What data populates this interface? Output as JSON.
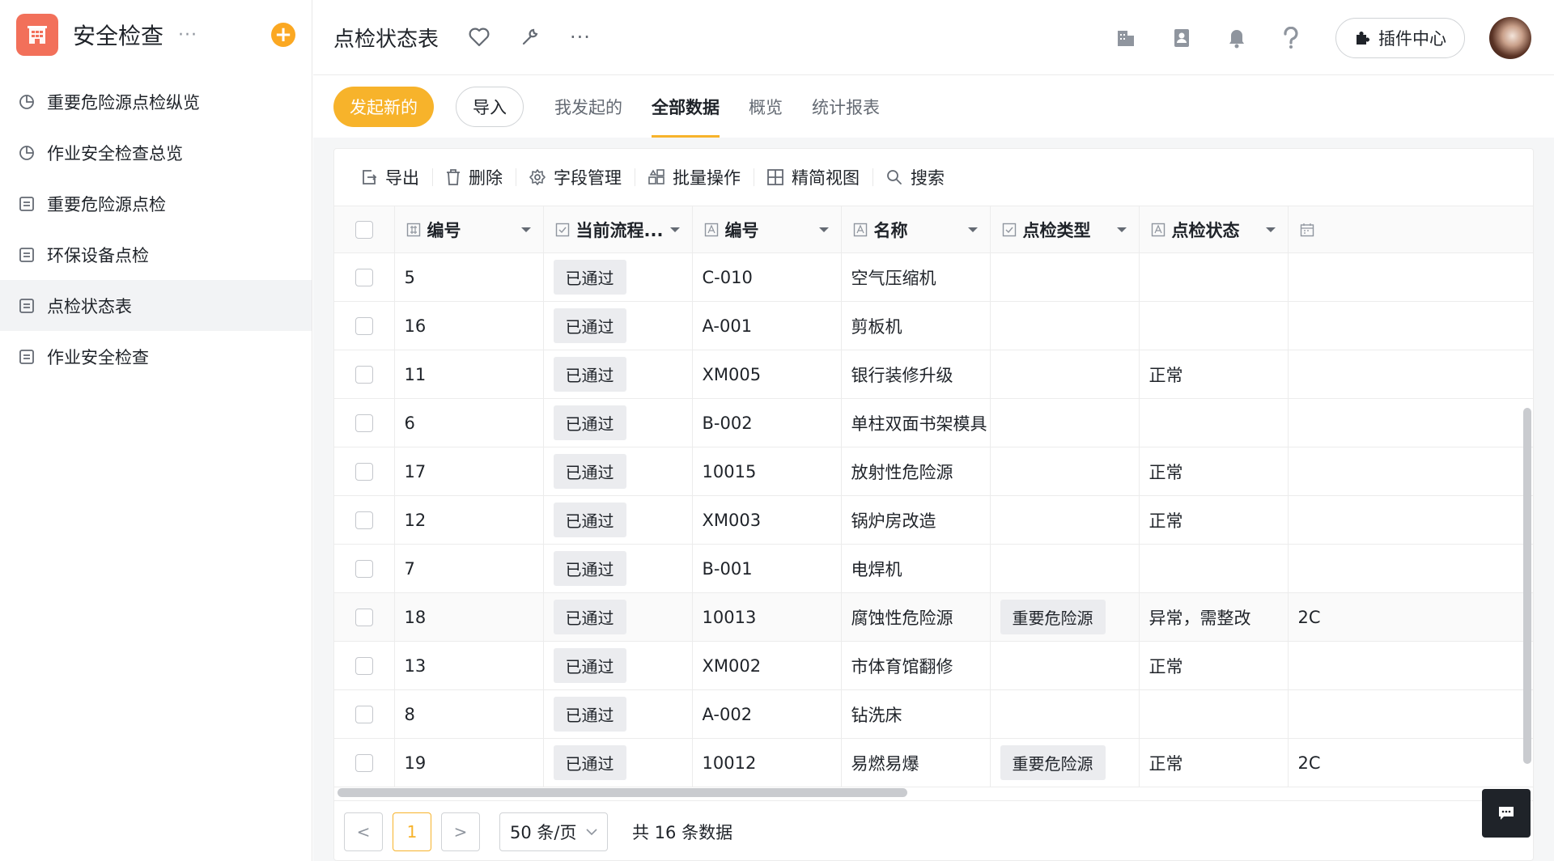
{
  "app": {
    "name": "安全检查",
    "more_label": "···"
  },
  "sidebar": {
    "items": [
      {
        "label": "重要危险源点检纵览",
        "icon": "pie-chart-icon",
        "active": false
      },
      {
        "label": "作业安全检查总览",
        "icon": "pie-chart-icon",
        "active": false
      },
      {
        "label": "重要危险源点检",
        "icon": "form-icon",
        "active": false
      },
      {
        "label": "环保设备点检",
        "icon": "form-icon",
        "active": false
      },
      {
        "label": "点检状态表",
        "icon": "form-icon",
        "active": true
      },
      {
        "label": "作业安全检查",
        "icon": "form-icon",
        "active": false
      }
    ]
  },
  "header": {
    "title": "点检状态表",
    "more_label": "···",
    "plugin_label": "插件中心"
  },
  "subbar": {
    "new_label": "发起新的",
    "import_label": "导入",
    "tabs": [
      {
        "label": "我发起的",
        "active": false
      },
      {
        "label": "全部数据",
        "active": true
      },
      {
        "label": "概览",
        "active": false
      },
      {
        "label": "统计报表",
        "active": false
      }
    ]
  },
  "toolbar": {
    "export_label": "导出",
    "delete_label": "删除",
    "fields_label": "字段管理",
    "batch_label": "批量操作",
    "view_label": "精简视图",
    "search_label": "搜索"
  },
  "table": {
    "columns": [
      "编号",
      "当前流程...",
      "编号",
      "名称",
      "点检类型",
      "点检状态"
    ],
    "rows": [
      {
        "id": "5",
        "status": "已通过",
        "code": "C-010",
        "name": "空气压缩机",
        "type": "",
        "state": "",
        "extra": ""
      },
      {
        "id": "16",
        "status": "已通过",
        "code": "A-001",
        "name": "剪板机",
        "type": "",
        "state": "",
        "extra": ""
      },
      {
        "id": "11",
        "status": "已通过",
        "code": "XM005",
        "name": "银行装修升级",
        "type": "",
        "state": "正常",
        "extra": ""
      },
      {
        "id": "6",
        "status": "已通过",
        "code": "B-002",
        "name": "单柱双面书架模具",
        "type": "",
        "state": "",
        "extra": ""
      },
      {
        "id": "17",
        "status": "已通过",
        "code": "10015",
        "name": "放射性危险源",
        "type": "",
        "state": "正常",
        "extra": ""
      },
      {
        "id": "12",
        "status": "已通过",
        "code": "XM003",
        "name": "锅炉房改造",
        "type": "",
        "state": "正常",
        "extra": ""
      },
      {
        "id": "7",
        "status": "已通过",
        "code": "B-001",
        "name": "电焊机",
        "type": "",
        "state": "",
        "extra": ""
      },
      {
        "id": "18",
        "status": "已通过",
        "code": "10013",
        "name": "腐蚀性危险源",
        "type": "重要危险源",
        "state": "异常，需整改",
        "extra": "2C"
      },
      {
        "id": "13",
        "status": "已通过",
        "code": "XM002",
        "name": "市体育馆翻修",
        "type": "",
        "state": "正常",
        "extra": ""
      },
      {
        "id": "8",
        "status": "已通过",
        "code": "A-002",
        "name": "钻洗床",
        "type": "",
        "state": "",
        "extra": ""
      },
      {
        "id": "19",
        "status": "已通过",
        "code": "10012",
        "name": "易燃易爆",
        "type": "重要危险源",
        "state": "正常",
        "extra": "2C"
      }
    ]
  },
  "pagination": {
    "prev_label": "<",
    "current_page": "1",
    "next_label": ">",
    "page_size_label": "50 条/页",
    "total_label": "共 16 条数据"
  },
  "colors": {
    "accent": "#f7b32b",
    "logo": "#f2705a",
    "add": "#fba822"
  }
}
